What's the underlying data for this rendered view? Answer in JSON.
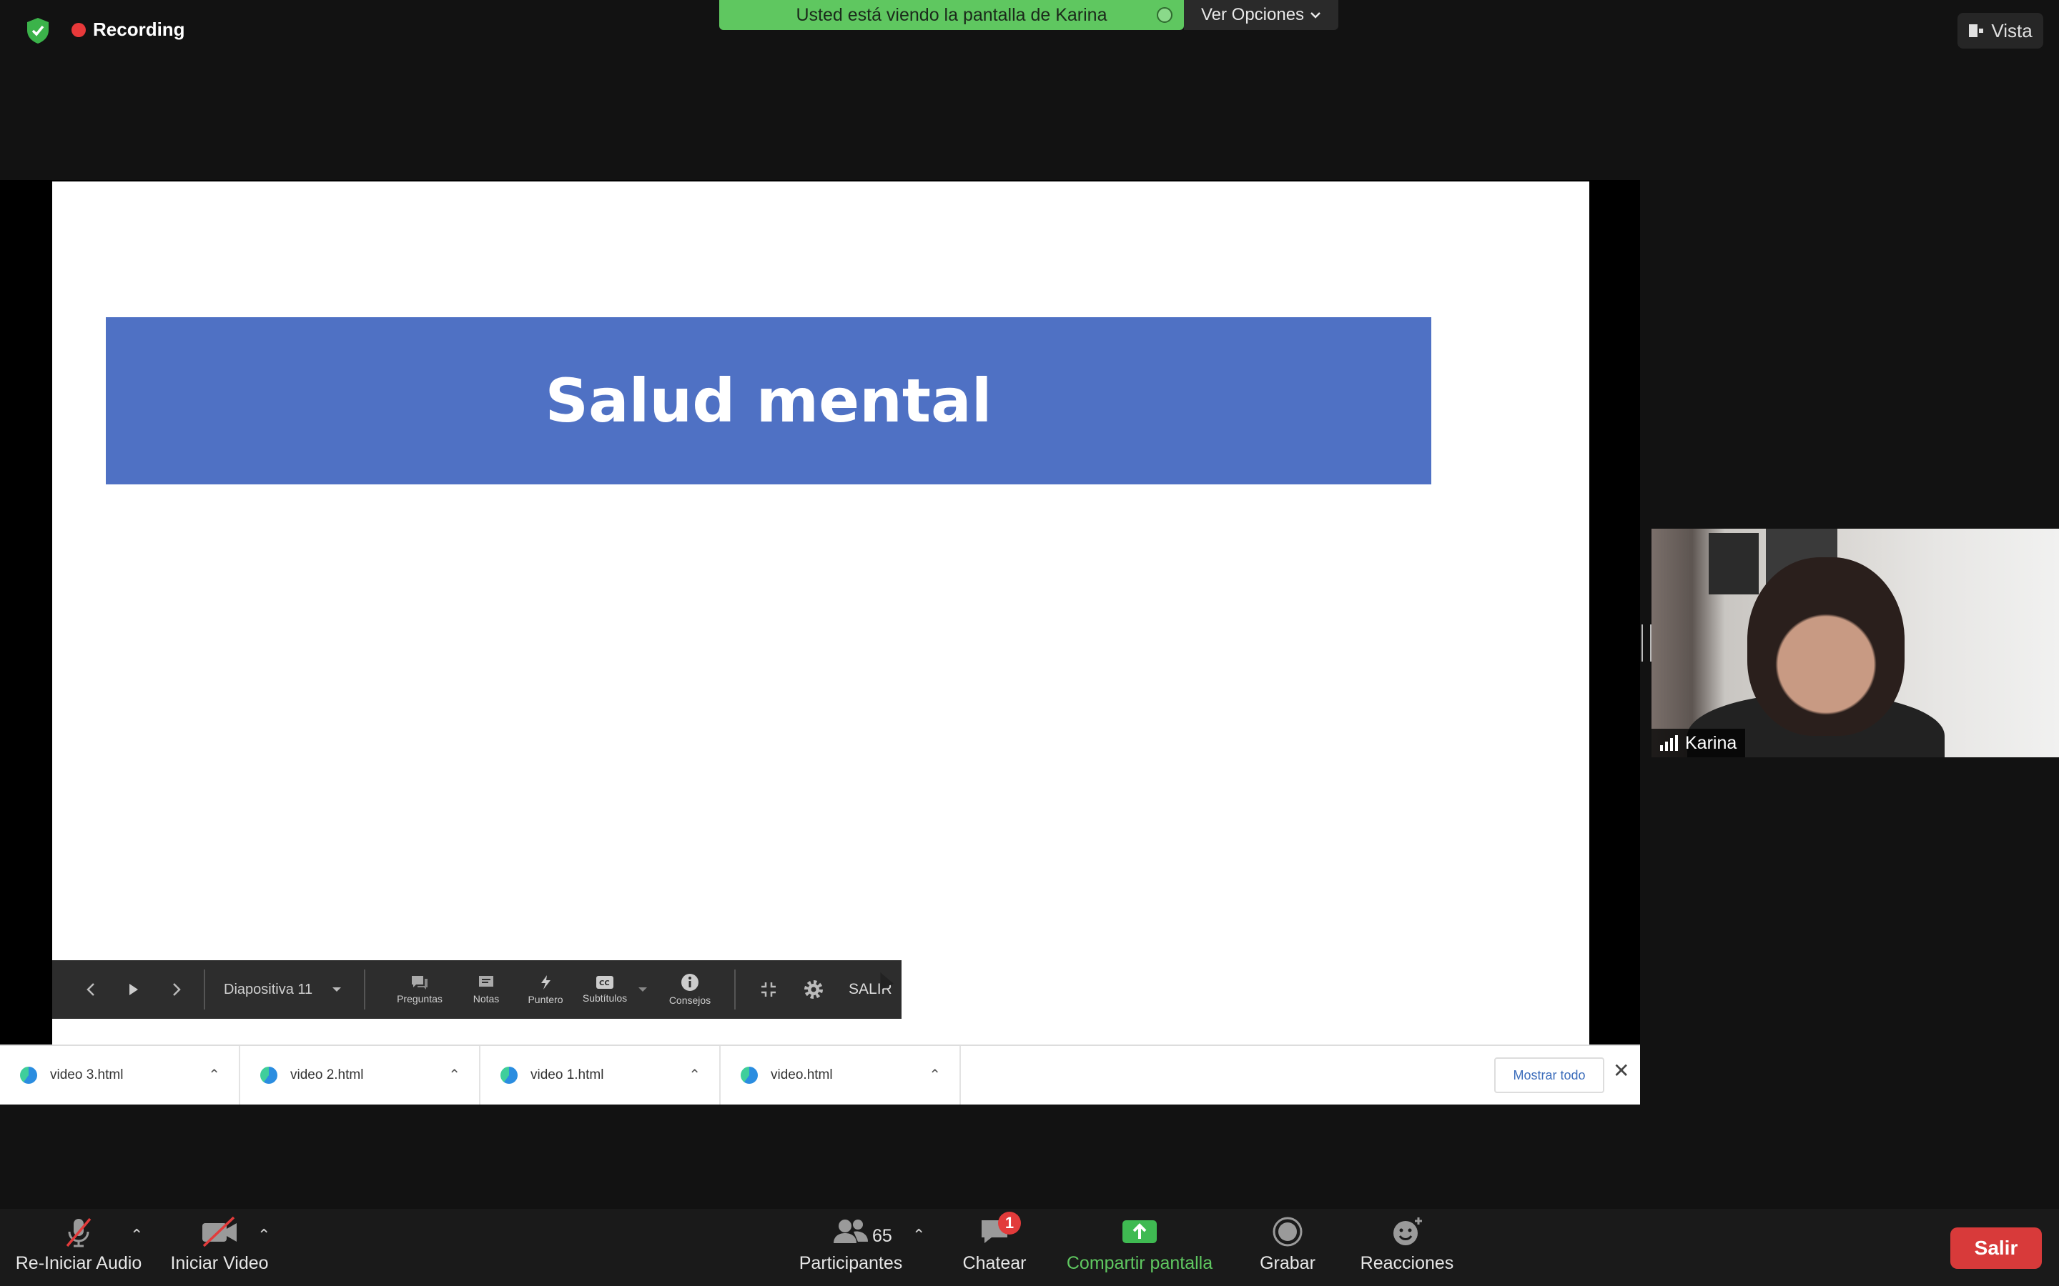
{
  "top": {
    "recording_label": "Recording",
    "banner_text": "Usted está viendo la pantalla de Karina",
    "options_label": "Ver Opciones",
    "view_label": "Vista"
  },
  "slide": {
    "title": "Salud mental"
  },
  "presentation_bar": {
    "slide_selector": "Diapositiva 11",
    "questions": "Preguntas",
    "notes": "Notas",
    "pointer": "Puntero",
    "subtitles": "Subtítulos",
    "tips": "Consejos",
    "exit": "SALIR"
  },
  "downloads": {
    "items": [
      "video 3.html",
      "video 2.html",
      "video 1.html",
      "video.html"
    ],
    "show_all": "Mostrar todo"
  },
  "video": {
    "participant_name": "Karina"
  },
  "toolbar": {
    "audio": "Re-Iniciar Audio",
    "video": "Iniciar Video",
    "participants_count": "65",
    "participants": "Participantes",
    "chat_badge": "1",
    "chat": "Chatear",
    "share": "Compartir pantalla",
    "record": "Grabar",
    "reactions": "Reacciones",
    "leave": "Salir"
  },
  "colors": {
    "accent_green": "#5fc760",
    "slide_blue": "#4f71c4",
    "leave_red": "#d83a3a"
  }
}
